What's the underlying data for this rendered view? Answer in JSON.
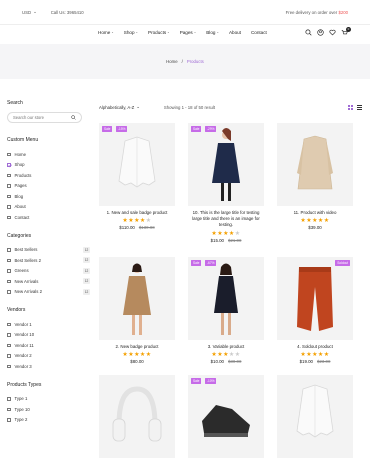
{
  "topbar": {
    "currency": "USD",
    "phone": "Call Us: 3965410",
    "promo_prefix": "Free delivery on order over ",
    "promo_amount": "$200"
  },
  "nav": [
    "Home",
    "Shop",
    "Products",
    "Pages",
    "Blog",
    "About",
    "Contact"
  ],
  "cart_count": "0",
  "breadcrumb": {
    "home": "Home",
    "sep": "/",
    "current": "Products"
  },
  "sidebar": {
    "search_title": "Search",
    "search_placeholder": "Search our store",
    "menu_title": "Custom Menu",
    "menu_items": [
      "Home",
      "Shop",
      "Products",
      "Pages",
      "Blog",
      "About",
      "Contact"
    ],
    "categories_title": "Categories",
    "categories": [
      {
        "label": "Best Sellers",
        "count": "12"
      },
      {
        "label": "Best Sellers 2",
        "count": "12"
      },
      {
        "label": "Greens",
        "count": "12"
      },
      {
        "label": "New Arrivals",
        "count": "12"
      },
      {
        "label": "New Arrivals 2",
        "count": "12"
      }
    ],
    "vendors_title": "Vendors",
    "vendors": [
      "Vendor 1",
      "Vendor 10",
      "Vendor 11",
      "Vendor 2",
      "Vendor 3"
    ],
    "types_title": "Products Types",
    "types": [
      "Type 1",
      "Type 10",
      "Type 2"
    ]
  },
  "toolbar": {
    "sort": "Alphabetically, A-Z",
    "result": "Showing 1 - 18 of 50 result"
  },
  "products": [
    {
      "title": "1. New and sale badge product",
      "rating": 4,
      "price": "$110.00",
      "old": "$130.00",
      "tags": [
        "Sale",
        "-15%"
      ]
    },
    {
      "title": "10. This is the large title for testing large title and there is an image for testing.",
      "rating": 4,
      "price": "$15.00",
      "old": "$21.00",
      "tags": [
        "Sale",
        "-29%"
      ]
    },
    {
      "title": "11. Product with video",
      "rating": 5,
      "price": "$39.00",
      "old": "",
      "tags": []
    },
    {
      "title": "2. New badge product",
      "rating": 5,
      "price": "$80.00",
      "old": "",
      "tags": []
    },
    {
      "title": "3. Variable product",
      "rating": 3,
      "price": "$10.00",
      "old": "$30.00",
      "tags": [
        "Sale",
        "-67%"
      ]
    },
    {
      "title": "4. Soldout product",
      "rating": 5,
      "price": "$19.00",
      "old": "$23.00",
      "tags": [
        "Soldout"
      ]
    },
    {
      "title": "",
      "rating": 0,
      "price": "",
      "old": "",
      "tags": []
    },
    {
      "title": "",
      "rating": 0,
      "price": "",
      "old": "",
      "tags": [
        "Sale",
        "-10%"
      ]
    },
    {
      "title": "",
      "rating": 0,
      "price": "",
      "old": "",
      "tags": []
    }
  ]
}
